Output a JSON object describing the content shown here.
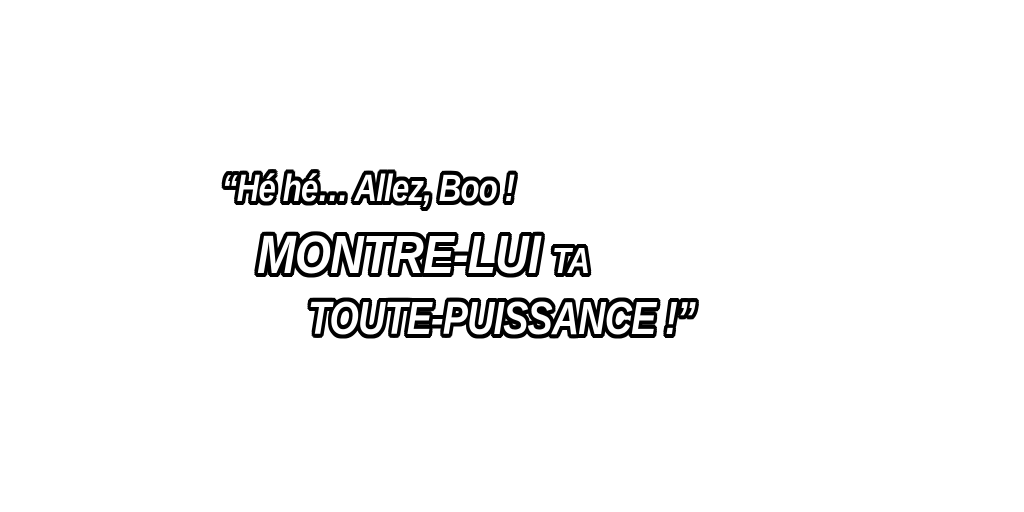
{
  "caption": {
    "line1": "“Hé hé… Allez, Boo !",
    "line2_main": "MONTRE-LUI ",
    "line2_small": "TA",
    "line3": "TOUTE-PUISSANCE !”"
  },
  "colors": {
    "fill": "#ffffff",
    "outline": "#000000",
    "background": "#ffffff"
  }
}
